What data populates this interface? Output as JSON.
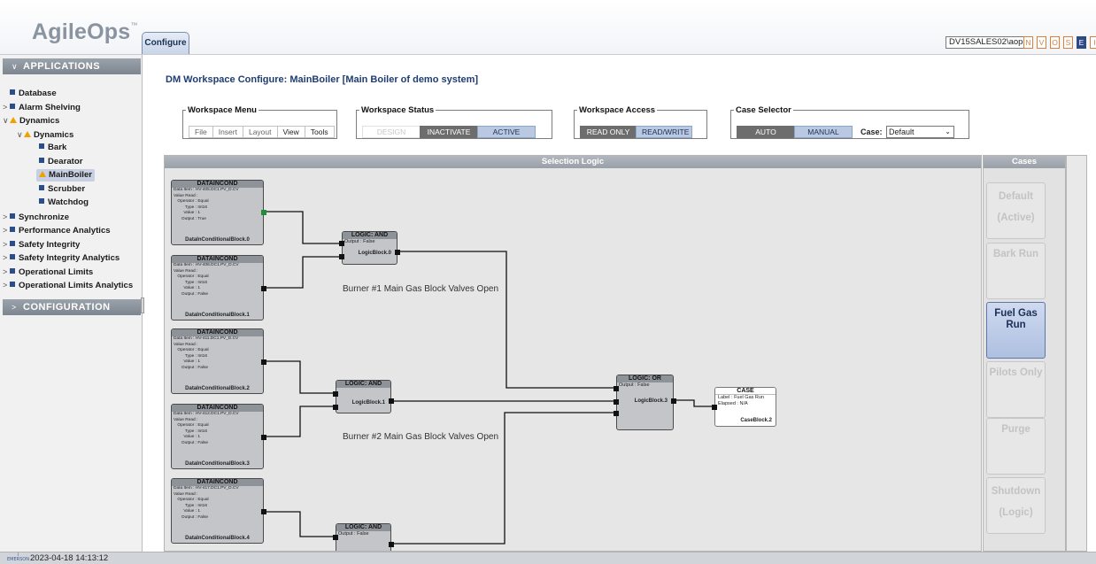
{
  "app": {
    "logo": "AgileOps",
    "logo_tm": "™",
    "tab": "Configure",
    "user": "DV15SALES02\\aops",
    "status_badges": [
      "N",
      "V",
      "O",
      "S",
      "E",
      "I"
    ]
  },
  "sidebar": {
    "applications_header": "APPLICATIONS",
    "items": [
      {
        "label": "Database"
      },
      {
        "label": "Alarm Shelving"
      },
      {
        "label": "Dynamics"
      },
      {
        "label": "Dynamics"
      },
      {
        "label": "Bark"
      },
      {
        "label": "Dearator"
      },
      {
        "label": "MainBoiler"
      },
      {
        "label": "Scrubber"
      },
      {
        "label": "Watchdog"
      },
      {
        "label": "Synchronize"
      },
      {
        "label": "Performance Analytics"
      },
      {
        "label": "Safety Integrity"
      },
      {
        "label": "Safety Integrity Analytics"
      },
      {
        "label": "Operational Limits"
      },
      {
        "label": "Operational Limits Analytics"
      }
    ],
    "configuration_header": "CONFIGURATION"
  },
  "main": {
    "title": "DM Workspace Configure: MainBoiler [Main Boiler of demo system]",
    "workspace_menu": {
      "legend": "Workspace Menu",
      "buttons": [
        "File",
        "Insert",
        "Layout",
        "View",
        "Tools"
      ]
    },
    "workspace_status": {
      "legend": "Workspace Status",
      "buttons": [
        "DESIGN",
        "INACTIVATE",
        "ACTIVE"
      ]
    },
    "workspace_access": {
      "legend": "Workspace Access",
      "buttons": [
        "READ ONLY",
        "READ/WRITE"
      ]
    },
    "case_selector": {
      "legend": "Case Selector",
      "buttons": [
        "AUTO",
        "MANUAL"
      ],
      "case_label": "Case:",
      "case_value": "Default"
    }
  },
  "canvas": {
    "title": "Selection Logic",
    "dic_blocks": [
      {
        "title": "DATAINCOND",
        "data_item": "HV-405.DC1.PV_D.CV",
        "operator": "Equal",
        "type": "Int16",
        "value": "1",
        "output": "True",
        "name": "DataInConditionalBlock.0"
      },
      {
        "title": "DATAINCOND",
        "data_item": "HV-406.DC1.PV_D.CV",
        "operator": "Equal",
        "type": "Int16",
        "value": "1",
        "output": "False",
        "name": "DataInConditionalBlock.1"
      },
      {
        "title": "DATAINCOND",
        "data_item": "HV-411.DC1.PV_D.CV",
        "operator": "Equal",
        "type": "Int16",
        "value": "1",
        "output": "False",
        "name": "DataInConditionalBlock.2"
      },
      {
        "title": "DATAINCOND",
        "data_item": "HV-412.DC1.PV_D.CV",
        "operator": "Equal",
        "type": "Int16",
        "value": "1",
        "output": "False",
        "name": "DataInConditionalBlock.3"
      },
      {
        "title": "DATAINCOND",
        "data_item": "HV-417.DC1.PV_D.CV",
        "operator": "Equal",
        "type": "Int16",
        "value": "1",
        "output": "False",
        "name": "DataInConditionalBlock.4"
      }
    ],
    "row_labels": {
      "data_item": "Data Item  :",
      "value_read": "Value Read :",
      "operator": "Operator :",
      "type": "Type :",
      "value": "Value :",
      "output": "Output :"
    },
    "logic_blocks": [
      {
        "title": "LOGIC: AND",
        "output": "False",
        "name": "LogicBlock.0"
      },
      {
        "title": "LOGIC: AND",
        "output": "False",
        "name": "LogicBlock.1"
      },
      {
        "title": "LOGIC: OR",
        "output": "False",
        "name": "LogicBlock.3"
      },
      {
        "title": "LOGIC: AND",
        "output": "False"
      }
    ],
    "output_label": "Output :",
    "case_block": {
      "title": "CASE",
      "label_key": "Label",
      "label": "Fuel Gas Run",
      "elapsed_key": "Elapsed :",
      "elapsed": "N/A",
      "name": "CaseBlock.2"
    },
    "annotations": [
      "Burner #1 Main Gas Block Valves Open",
      "Burner #2 Main Gas Block Valves Open"
    ]
  },
  "cases": {
    "title": "Cases",
    "items": [
      "Default",
      "(Active)",
      "Bark Run",
      "Fuel Gas Run",
      "Pilots Only",
      "Purge",
      "Shutdown",
      "(Logic)"
    ]
  },
  "footer": {
    "logo": "EMERSON",
    "timestamp": "2023-04-18  14:13:12"
  }
}
